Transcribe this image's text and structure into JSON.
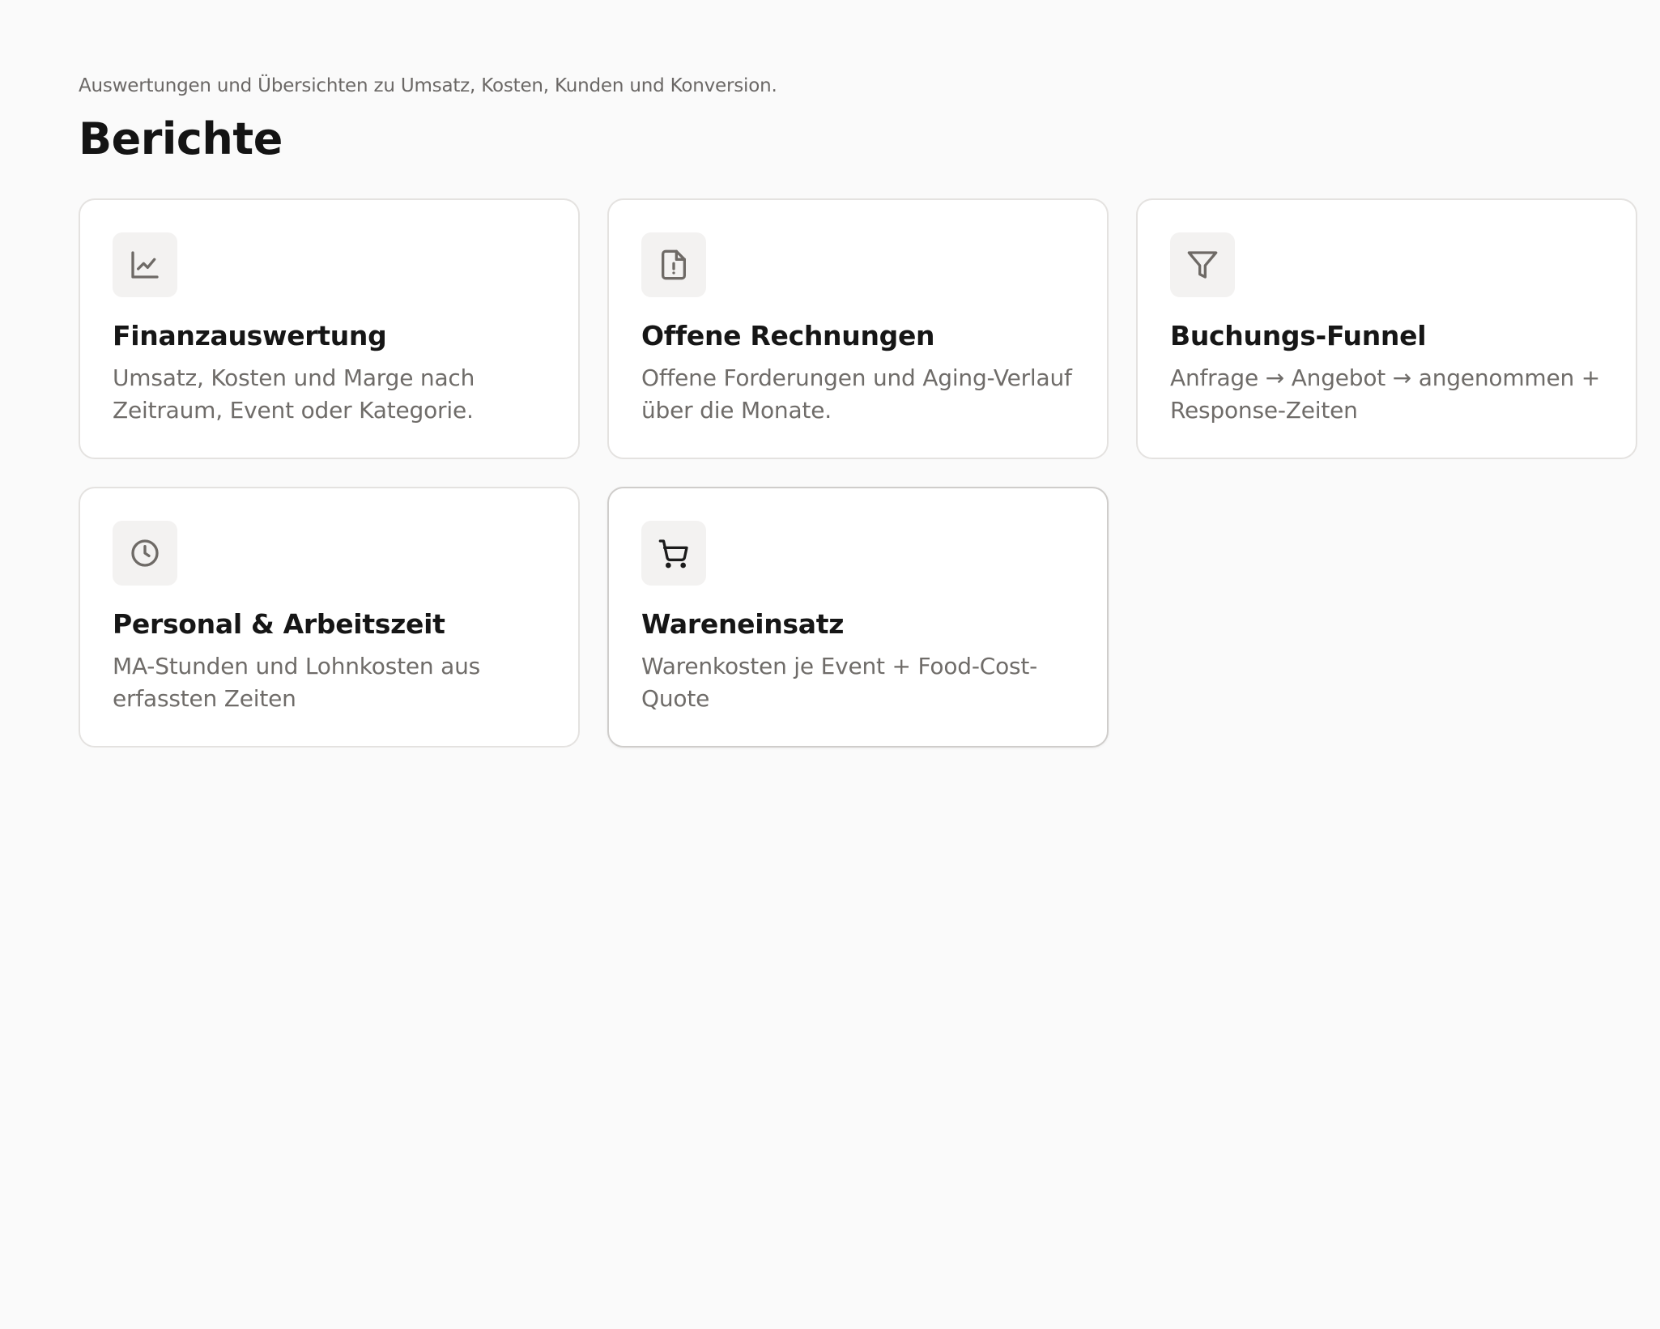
{
  "header": {
    "subtitle": "Auswertungen und Übersichten zu Umsatz, Kosten, Kunden und Konversion.",
    "title": "Berichte"
  },
  "reports": [
    {
      "icon": "line-chart-icon",
      "title": "Finanzauswertung",
      "description": "Umsatz, Kosten und Marge nach Zeitraum, Event oder Kategorie."
    },
    {
      "icon": "invoice-alert-icon",
      "title": "Offene Rechnungen",
      "description": "Offene Forderungen und Aging-Verlauf über die Monate."
    },
    {
      "icon": "funnel-icon",
      "title": "Buchungs-Funnel",
      "description": "Anfrage → Angebot → angenommen + Response-Zeiten"
    },
    {
      "icon": "clock-icon",
      "title": "Personal & Arbeitszeit",
      "description": "MA-Stunden und Lohnkosten aus erfassten Zeiten"
    },
    {
      "icon": "shopping-cart-icon",
      "title": "Wareneinsatz",
      "description": "Warenkosten je Event + Food-Cost-Quote"
    }
  ],
  "colors": {
    "background": "#fafafa",
    "card": "#ffffff",
    "card_border": "#e4e2e0",
    "icon_bg": "#f3f2f1",
    "title_text": "#161616",
    "muted_text": "#6f6c69"
  }
}
